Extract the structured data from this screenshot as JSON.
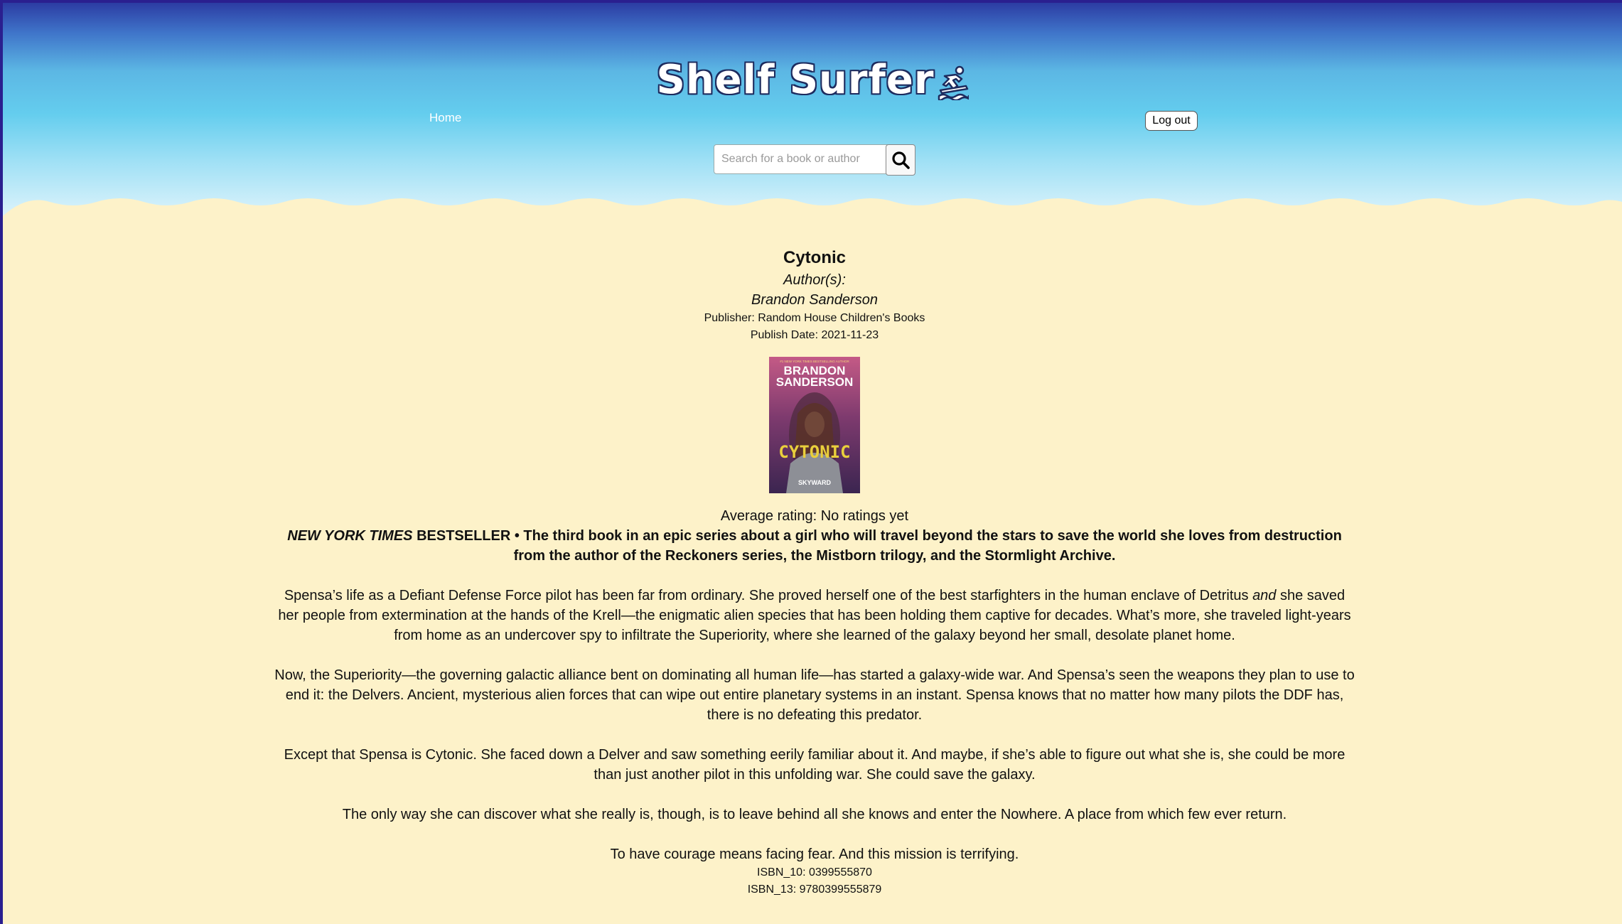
{
  "header": {
    "logo_text": "Shelf Surfer",
    "home_link": "Home",
    "logout_label": "Log out",
    "search": {
      "placeholder": "Search for a book or author",
      "value": ""
    }
  },
  "book": {
    "title": "Cytonic",
    "authors_label": "Author(s):",
    "author": "Brandon Sanderson",
    "publisher": "Publisher: Random House Children's Books",
    "publish_date": "Publish Date: 2021-11-23",
    "cover": {
      "author_top": "BRANDON",
      "author_bottom": "SANDERSON",
      "tagline": "#1 NEW YORK TIMES BESTSELLING AUTHOR",
      "title": "CYTONIC",
      "series": "SKYWARD"
    },
    "average_rating": "Average rating: No ratings yet",
    "description": {
      "lead_italic": "NEW YORK TIMES",
      "lead_rest": " BESTSELLER • The third book in an epic series about a girl who will travel beyond the stars to save the world she loves from destruction from the author of the Reckoners series, the Mistborn trilogy, and the Stormlight Archive.",
      "p1_a": "Spensa’s life as a Defiant Defense Force pilot has been far from ordinary. She proved herself one of the best starfighters in the human enclave of Detritus ",
      "p1_em": "and",
      "p1_b": " she saved her people from extermination at the hands of the Krell—the enigmatic alien species that has been holding them captive for decades. What’s more, she traveled light-years from home as an undercover spy to infiltrate the Superiority, where she learned of the galaxy beyond her small, desolate planet home.",
      "p2": "Now, the Superiority—the governing galactic alliance bent on dominating all human life—has started a galaxy-wide war. And Spensa’s seen the weapons they plan to use to end it: the Delvers. Ancient, mysterious alien forces that can wipe out entire planetary systems in an instant. Spensa knows that no matter how many pilots the DDF has, there is no defeating this predator.",
      "p3": "Except that Spensa is Cytonic. She faced down a Delver and saw something eerily familiar about it. And maybe, if she’s able to figure out what she is, she could be more than just another pilot in this unfolding war. She could save the galaxy.",
      "p4": "The only way she can discover what she really is, though, is to leave behind all she knows and enter the Nowhere. A place from which few ever return.",
      "p5": "To have courage means facing fear. And this mission is terrifying."
    },
    "isbn_10": "ISBN_10: 0399555870",
    "isbn_13": "ISBN_13: 9780399555879"
  },
  "colors": {
    "background_sand": "#fdf2c9",
    "sky_top": "#2c3ca3",
    "sky_mid": "#64cdee",
    "window_border": "#2a1f8f"
  },
  "icons": {
    "logo_glyph": "surfer-icon",
    "search_button": "search-icon"
  }
}
